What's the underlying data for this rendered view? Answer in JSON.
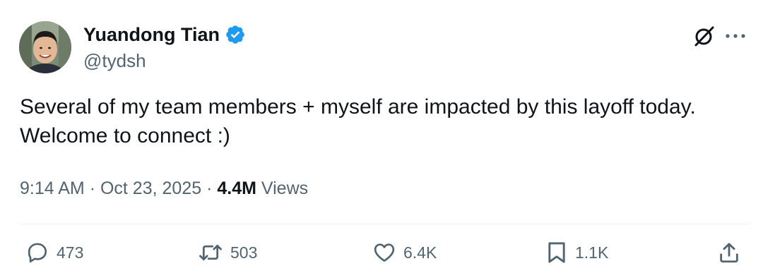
{
  "author": {
    "display_name": "Yuandong Tian",
    "handle": "@tydsh",
    "verified": true,
    "verified_color": "#1d9bf0"
  },
  "header_actions": {
    "grok_icon": "grok-icon",
    "more_icon": "more-icon"
  },
  "tweet": {
    "text_lines": [
      "Several of my team members + myself are impacted by this layoff today.",
      "Welcome to connect :)"
    ]
  },
  "meta": {
    "time": "9:14 AM",
    "separator": "·",
    "date": "Oct 23, 2025",
    "views_count": "4.4M",
    "views_label": "Views"
  },
  "actions": {
    "replies": "473",
    "reposts": "503",
    "likes": "6.4K",
    "bookmarks": "1.1K"
  },
  "colors": {
    "text_primary": "#0f1419",
    "text_secondary": "#536471",
    "icon": "#536471",
    "divider": "#eff3f4"
  }
}
